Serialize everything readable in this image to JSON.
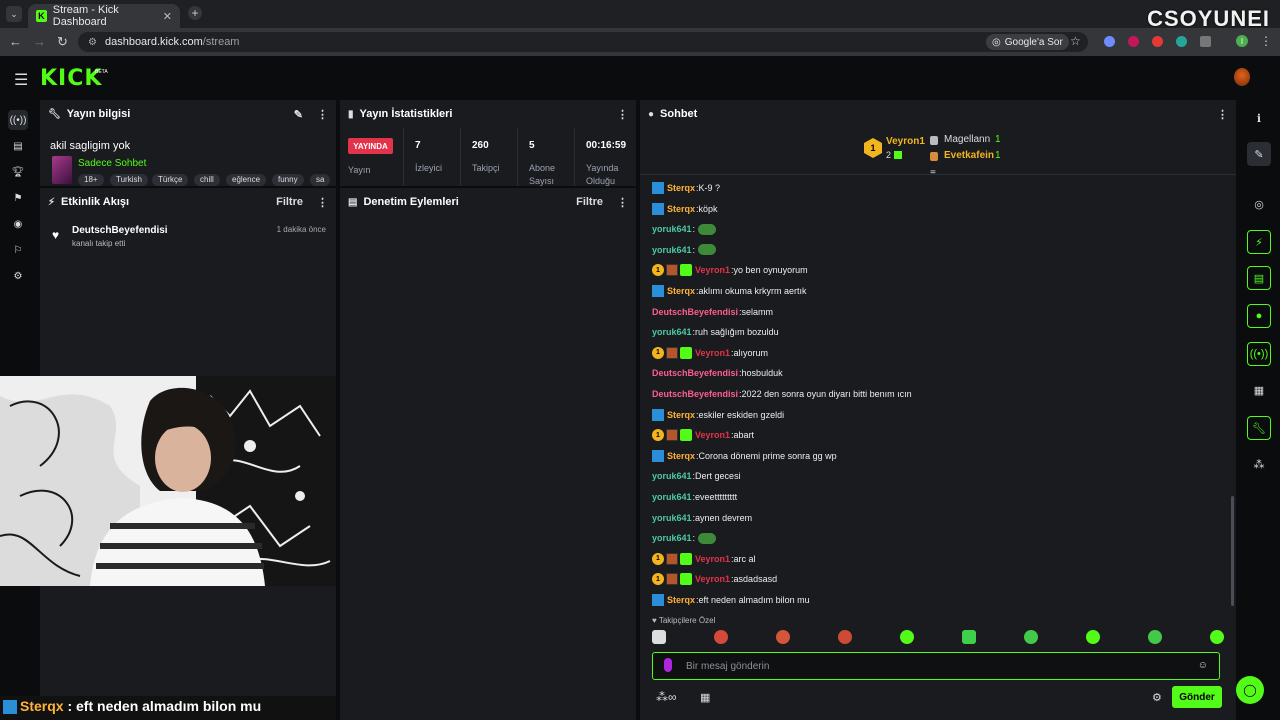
{
  "browser": {
    "tab_title": "Stream - Kick Dashboard",
    "url_host": "dashboard.kick.com",
    "url_path": "/stream",
    "google_chip": "Google'a Sor",
    "profile_initial": "I"
  },
  "watermark": "CSOYUNEI",
  "app": {
    "logo": "KICK",
    "beta": "BETA"
  },
  "info_panel": {
    "title": "Yayın bilgisi",
    "stream_title": "akil sagligim yok",
    "category": "Sadece Sohbet",
    "tags": [
      "18+",
      "Turkish",
      "Türkçe",
      "chill",
      "eğlence",
      "funny",
      "sa"
    ]
  },
  "stats_panel": {
    "title": "Yayın İstatistikleri",
    "live_badge": "YAYINDA",
    "live_label": "Yayın",
    "stats": [
      {
        "value": "7",
        "label1": "İzleyici",
        "label2": ""
      },
      {
        "value": "260",
        "label1": "Takipçi",
        "label2": ""
      },
      {
        "value": "5",
        "label1": "Abone",
        "label2": "Sayısı"
      },
      {
        "value": "00:16:59",
        "label1": "Yayında",
        "label2": "Olduğu"
      }
    ]
  },
  "activity_panel": {
    "title": "Etkinlik Akışı",
    "filter": "Filtre",
    "item": {
      "user": "DeutschBeyefendisi",
      "desc": "kanalı takip etti",
      "time": "1 dakika önce"
    }
  },
  "mod_panel": {
    "title": "Denetim Eylemleri",
    "filter": "Filtre"
  },
  "chat": {
    "title": "Sohbet",
    "leaderboard": {
      "first": {
        "name": "Veyron1",
        "count": "2"
      },
      "second": {
        "name": "Magellann",
        "count": "1"
      },
      "third": {
        "name": "Evetkafein",
        "count": "1"
      }
    },
    "messages": [
      {
        "user": "Sterqx",
        "text": "K-9 ?",
        "kind": "sterqx"
      },
      {
        "user": "Sterqx",
        "text": "köpk",
        "kind": "sterqx"
      },
      {
        "user": "yoruk641",
        "text": "",
        "kind": "yoruk",
        "emote": true
      },
      {
        "user": "yoruk641",
        "text": "",
        "kind": "yoruk",
        "emote": true
      },
      {
        "user": "Veyron1",
        "text": "yo ben oynuyorum",
        "kind": "veyron"
      },
      {
        "user": "Sterqx",
        "text": "aklımı okuma krkyrm aertık",
        "kind": "sterqx"
      },
      {
        "user": "DeutschBeyefendisi",
        "text": "selamm",
        "kind": "deutsch"
      },
      {
        "user": "yoruk641",
        "text": "ruh sağlığım bozuldu",
        "kind": "yoruk"
      },
      {
        "user": "Veyron1",
        "text": "alıyorum",
        "kind": "veyron"
      },
      {
        "user": "DeutschBeyefendisi",
        "text": "hosbulduk",
        "kind": "deutsch"
      },
      {
        "user": "DeutschBeyefendisi",
        "text": "2022 den sonra oyun diyarı bitti benım ıcın",
        "kind": "deutsch"
      },
      {
        "user": "Sterqx",
        "text": "eskiler eskiden gzeldi",
        "kind": "sterqx"
      },
      {
        "user": "Veyron1",
        "text": "abart",
        "kind": "veyron"
      },
      {
        "user": "Sterqx",
        "text": "Corona dönemi prime sonra gg wp",
        "kind": "sterqx"
      },
      {
        "user": "yoruk641",
        "text": "Dert gecesi",
        "kind": "yoruk"
      },
      {
        "user": "yoruk641",
        "text": "eveettttttttt",
        "kind": "yoruk"
      },
      {
        "user": "yoruk641",
        "text": "aynen devrem",
        "kind": "yoruk"
      },
      {
        "user": "yoruk641",
        "text": "",
        "kind": "yoruk",
        "emote": true
      },
      {
        "user": "Veyron1",
        "text": "arc al",
        "kind": "veyron"
      },
      {
        "user": "Veyron1",
        "text": "asdadsasd",
        "kind": "veyron"
      },
      {
        "user": "Sterqx",
        "text": "eft neden almadım bilon mu",
        "kind": "sterqx"
      }
    ],
    "followers_label": "Takipçilere Özel",
    "placeholder": "Bir mesaj gönderin",
    "send": "Gönder"
  },
  "overlay": {
    "user": "Sterqx",
    "text": " : eft neden almadım bilon mu"
  },
  "colors": {
    "kick_green": "#53fc18",
    "sterqx": "#ffb338",
    "yoruk": "#4ec9a4",
    "veyron": "#e2334a",
    "deutsch": "#ff5d8f",
    "live": "#e2334a"
  }
}
